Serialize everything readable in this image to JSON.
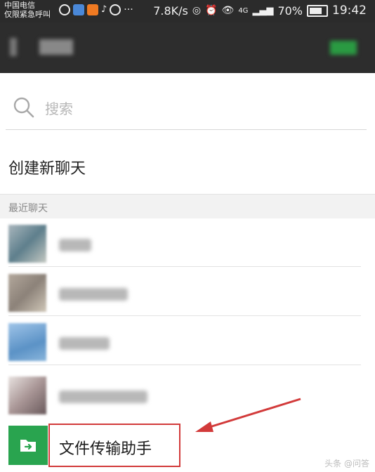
{
  "status_bar": {
    "carrier_line1": "中国电信",
    "carrier_line2": "仅限紧急呼叫",
    "network_speed": "7.8K/s",
    "network_type": "4G",
    "battery": "70%",
    "time": "19:42"
  },
  "search": {
    "placeholder": "搜索",
    "icon": "search-icon"
  },
  "menu": {
    "create_new_chat": "创建新聊天"
  },
  "recent": {
    "section_title": "最近聊天",
    "items": [
      {
        "avatar_color": "#7f98a6",
        "name": ""
      },
      {
        "avatar_color": "#9c9289",
        "name": ""
      },
      {
        "avatar_color": "#6f9fcd",
        "name": ""
      },
      {
        "avatar_color": "#b5a7a7",
        "name": ""
      }
    ]
  },
  "file_transfer": {
    "label": "文件传输助手",
    "icon": "folder-arrow-icon",
    "icon_color": "#29a44f"
  },
  "annotation": {
    "arrow_color": "#d23a3a"
  },
  "watermark": "头条 @问答"
}
